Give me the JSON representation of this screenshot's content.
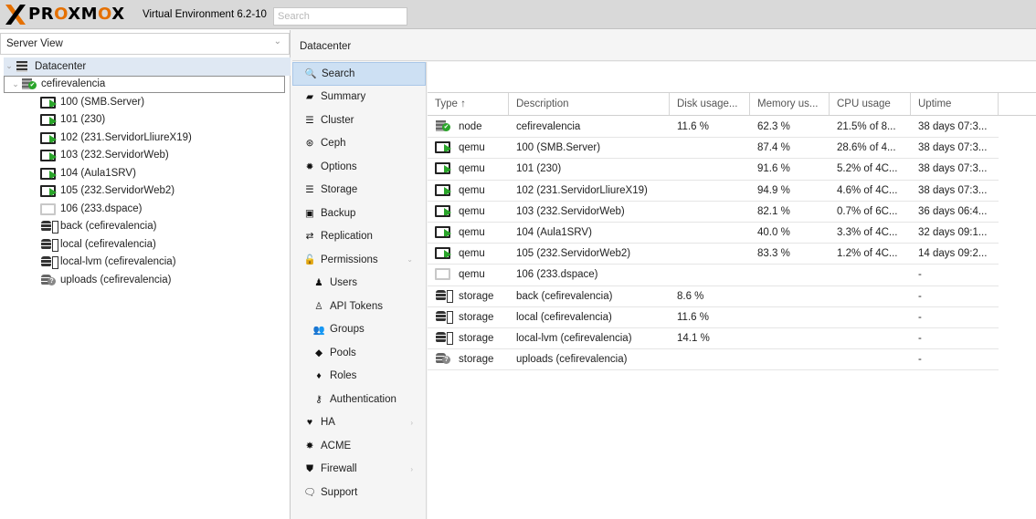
{
  "app": {
    "brand": "PROXMOX",
    "version": "Virtual Environment 6.2-10",
    "search_placeholder": "Search"
  },
  "left": {
    "view": "Server View",
    "tree": [
      {
        "label": "Datacenter",
        "icon": "datacenter-icon",
        "kind": "dc"
      },
      {
        "label": "cefirevalencia",
        "icon": "node-icon",
        "kind": "node"
      },
      {
        "label": "100 (SMB.Server)",
        "icon": "vm-running-icon",
        "kind": "vm"
      },
      {
        "label": "101 (230)",
        "icon": "vm-running-icon",
        "kind": "vm"
      },
      {
        "label": "102 (231.ServidorLliureX19)",
        "icon": "vm-running-icon",
        "kind": "vm"
      },
      {
        "label": "103 (232.ServidorWeb)",
        "icon": "vm-running-icon",
        "kind": "vm"
      },
      {
        "label": "104 (Aula1SRV)",
        "icon": "vm-running-icon",
        "kind": "vm"
      },
      {
        "label": "105 (232.ServidorWeb2)",
        "icon": "vm-running-icon",
        "kind": "vm"
      },
      {
        "label": "106 (233.dspace)",
        "icon": "vm-stopped-icon",
        "kind": "vm-off"
      },
      {
        "label": "back (cefirevalencia)",
        "icon": "storage-icon",
        "kind": "db"
      },
      {
        "label": "local (cefirevalencia)",
        "icon": "storage-icon",
        "kind": "db"
      },
      {
        "label": "local-lvm (cefirevalencia)",
        "icon": "storage-icon",
        "kind": "db"
      },
      {
        "label": "uploads (cefirevalencia)",
        "icon": "storage-unknown-icon",
        "kind": "share"
      }
    ]
  },
  "content": {
    "title": "Datacenter"
  },
  "menu": [
    {
      "label": "Search",
      "icon": "search-icon",
      "glyph": "🔍",
      "active": true
    },
    {
      "label": "Summary",
      "icon": "book-icon",
      "glyph": "▰"
    },
    {
      "label": "Cluster",
      "icon": "server-icon",
      "glyph": "☰"
    },
    {
      "label": "Ceph",
      "icon": "ceph-icon",
      "glyph": "⊛"
    },
    {
      "label": "Options",
      "icon": "gear-icon",
      "glyph": "✹"
    },
    {
      "label": "Storage",
      "icon": "database-icon",
      "glyph": "☰"
    },
    {
      "label": "Backup",
      "icon": "floppy-icon",
      "glyph": "▣"
    },
    {
      "label": "Replication",
      "icon": "retweet-icon",
      "glyph": "⇄"
    },
    {
      "label": "Permissions",
      "icon": "unlock-icon",
      "glyph": "🔓",
      "expand": "⌄"
    },
    {
      "label": "Users",
      "icon": "user-icon",
      "glyph": "♟",
      "sub": true
    },
    {
      "label": "API Tokens",
      "icon": "user-outline-icon",
      "glyph": "♙",
      "sub": true
    },
    {
      "label": "Groups",
      "icon": "users-icon",
      "glyph": "👥",
      "sub": true
    },
    {
      "label": "Pools",
      "icon": "tags-icon",
      "glyph": "◆",
      "sub": true
    },
    {
      "label": "Roles",
      "icon": "male-icon",
      "glyph": "♦",
      "sub": true
    },
    {
      "label": "Authentication",
      "icon": "key-icon",
      "glyph": "⚷",
      "sub": true
    },
    {
      "label": "HA",
      "icon": "heartbeat-icon",
      "glyph": "♥",
      "expand": "›"
    },
    {
      "label": "ACME",
      "icon": "certificate-icon",
      "glyph": "✸"
    },
    {
      "label": "Firewall",
      "icon": "shield-icon",
      "glyph": "⛊",
      "expand": "›"
    },
    {
      "label": "Support",
      "icon": "comments-icon",
      "glyph": "🗨"
    }
  ],
  "table": {
    "headers": [
      "Type ↑",
      "Description",
      "Disk usage...",
      "Memory us...",
      "CPU usage",
      "Uptime"
    ],
    "rows": [
      {
        "icon": "node-icon",
        "kind": "node",
        "type": "node",
        "desc": "cefirevalencia",
        "disk": "11.6 %",
        "mem": "62.3 %",
        "cpu": "21.5% of 8...",
        "uptime": "38 days 07:3..."
      },
      {
        "icon": "vm-running-icon",
        "kind": "vm",
        "type": "qemu",
        "desc": "100 (SMB.Server)",
        "disk": "",
        "mem": "87.4 %",
        "cpu": "28.6% of 4...",
        "uptime": "38 days 07:3..."
      },
      {
        "icon": "vm-running-icon",
        "kind": "vm",
        "type": "qemu",
        "desc": "101 (230)",
        "disk": "",
        "mem": "91.6 %",
        "cpu": "5.2% of 4C...",
        "uptime": "38 days 07:3..."
      },
      {
        "icon": "vm-running-icon",
        "kind": "vm",
        "type": "qemu",
        "desc": "102 (231.ServidorLliureX19)",
        "disk": "",
        "mem": "94.9 %",
        "cpu": "4.6% of 4C...",
        "uptime": "38 days 07:3..."
      },
      {
        "icon": "vm-running-icon",
        "kind": "vm",
        "type": "qemu",
        "desc": "103 (232.ServidorWeb)",
        "disk": "",
        "mem": "82.1 %",
        "cpu": "0.7% of 6C...",
        "uptime": "36 days 06:4..."
      },
      {
        "icon": "vm-running-icon",
        "kind": "vm",
        "type": "qemu",
        "desc": "104 (Aula1SRV)",
        "disk": "",
        "mem": "40.0 %",
        "cpu": "3.3% of 4C...",
        "uptime": "32 days 09:1..."
      },
      {
        "icon": "vm-running-icon",
        "kind": "vm",
        "type": "qemu",
        "desc": "105 (232.ServidorWeb2)",
        "disk": "",
        "mem": "83.3 %",
        "cpu": "1.2% of 4C...",
        "uptime": "14 days 09:2..."
      },
      {
        "icon": "vm-stopped-icon",
        "kind": "vm-off",
        "type": "qemu",
        "desc": "106 (233.dspace)",
        "disk": "",
        "mem": "",
        "cpu": "",
        "uptime": "-"
      },
      {
        "icon": "storage-icon",
        "kind": "db",
        "type": "storage",
        "desc": "back (cefirevalencia)",
        "disk": "8.6 %",
        "mem": "",
        "cpu": "",
        "uptime": "-"
      },
      {
        "icon": "storage-icon",
        "kind": "db",
        "type": "storage",
        "desc": "local (cefirevalencia)",
        "disk": "11.6 %",
        "mem": "",
        "cpu": "",
        "uptime": "-"
      },
      {
        "icon": "storage-icon",
        "kind": "db",
        "type": "storage",
        "desc": "local-lvm (cefirevalencia)",
        "disk": "14.1 %",
        "mem": "",
        "cpu": "",
        "uptime": "-"
      },
      {
        "icon": "storage-unknown-icon",
        "kind": "share",
        "type": "storage",
        "desc": "uploads (cefirevalencia)",
        "disk": "",
        "mem": "",
        "cpu": "",
        "uptime": "-"
      }
    ]
  },
  "colors": {
    "brand_accent": "#e57000",
    "running_green": "#2aa52a",
    "selection_blue": "#cde0f3"
  }
}
